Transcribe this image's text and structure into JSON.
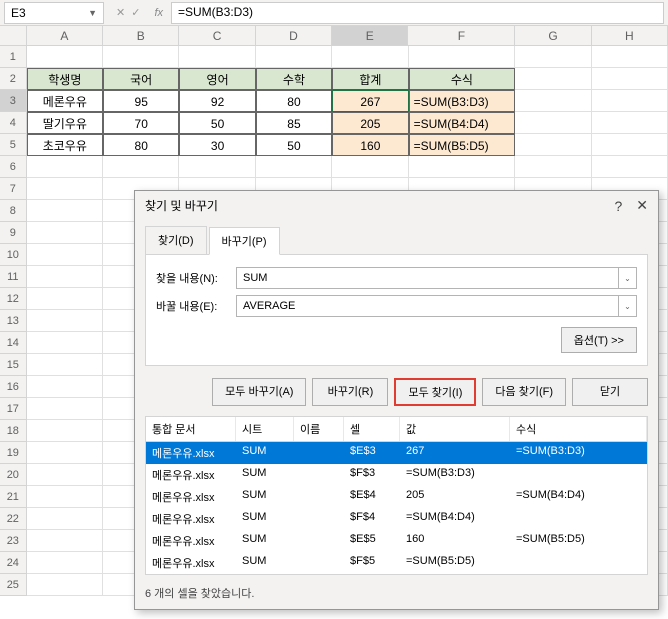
{
  "nameBox": "E3",
  "formulaBar": "=SUM(B3:D3)",
  "columns": [
    "A",
    "B",
    "C",
    "D",
    "E",
    "F",
    "G",
    "H"
  ],
  "rows": [
    "1",
    "2",
    "3",
    "4",
    "5",
    "6",
    "7",
    "8",
    "9",
    "10",
    "11",
    "12",
    "13",
    "14",
    "15",
    "16",
    "17",
    "18",
    "19",
    "20",
    "21",
    "22",
    "23",
    "24",
    "25"
  ],
  "table": {
    "headers": [
      "학생명",
      "국어",
      "영어",
      "수학",
      "합계",
      "수식"
    ],
    "data": [
      {
        "name": "메론우유",
        "kor": "95",
        "eng": "92",
        "math": "80",
        "sum": "267",
        "formula": "=SUM(B3:D3)"
      },
      {
        "name": "딸기우유",
        "kor": "70",
        "eng": "50",
        "math": "85",
        "sum": "205",
        "formula": "=SUM(B4:D4)"
      },
      {
        "name": "초코우유",
        "kor": "80",
        "eng": "30",
        "math": "50",
        "sum": "160",
        "formula": "=SUM(B5:D5)"
      }
    ]
  },
  "dialog": {
    "title": "찾기 및 바꾸기",
    "tabs": {
      "find": "찾기(D)",
      "replace": "바꾸기(P)"
    },
    "labels": {
      "findWhat": "찾을 내용(N):",
      "replaceWith": "바꿀 내용(E):"
    },
    "findValue": "SUM",
    "replaceValue": "AVERAGE",
    "buttons": {
      "options": "옵션(T) >>",
      "replaceAll": "모두 바꾸기(A)",
      "replace": "바꾸기(R)",
      "findAll": "모두 찾기(I)",
      "findNext": "다음 찾기(F)",
      "close": "닫기"
    },
    "resultHeaders": {
      "book": "통합 문서",
      "sheet": "시트",
      "name": "이름",
      "cell": "셀",
      "value": "값",
      "formula": "수식"
    },
    "results": [
      {
        "book": "메론우유.xlsx",
        "sheet": "SUM",
        "name": "",
        "cell": "$E$3",
        "value": "267",
        "formula": "=SUM(B3:D3)"
      },
      {
        "book": "메론우유.xlsx",
        "sheet": "SUM",
        "name": "",
        "cell": "$F$3",
        "value": "=SUM(B3:D3)",
        "formula": ""
      },
      {
        "book": "메론우유.xlsx",
        "sheet": "SUM",
        "name": "",
        "cell": "$E$4",
        "value": "205",
        "formula": "=SUM(B4:D4)"
      },
      {
        "book": "메론우유.xlsx",
        "sheet": "SUM",
        "name": "",
        "cell": "$F$4",
        "value": "=SUM(B4:D4)",
        "formula": ""
      },
      {
        "book": "메론우유.xlsx",
        "sheet": "SUM",
        "name": "",
        "cell": "$E$5",
        "value": "160",
        "formula": "=SUM(B5:D5)"
      },
      {
        "book": "메론우유.xlsx",
        "sheet": "SUM",
        "name": "",
        "cell": "$F$5",
        "value": "=SUM(B5:D5)",
        "formula": ""
      }
    ],
    "status": "6 개의 셀을 찾았습니다."
  }
}
